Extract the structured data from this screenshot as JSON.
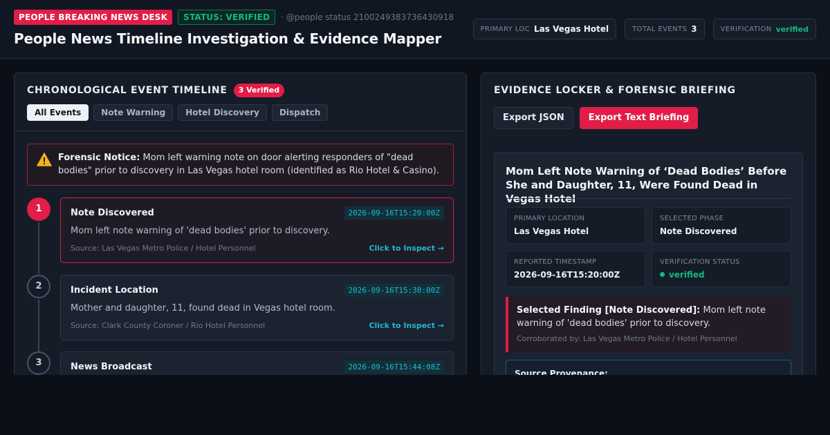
{
  "header": {
    "desk_badge": "PEOPLE BREAKING NEWS DESK",
    "status_badge": "STATUS: VERIFIED",
    "status_id": "· @people status 2100249383736430918",
    "title": "People News Timeline Investigation & Evidence Mapper",
    "stats": [
      {
        "label": "PRIMARY LOC",
        "value": "Las Vegas Hotel"
      },
      {
        "label": "TOTAL EVENTS",
        "value": "3"
      },
      {
        "label": "VERIFICATION",
        "value": "verified"
      }
    ]
  },
  "timeline_panel": {
    "title": "CHRONOLOGICAL EVENT TIMELINE",
    "count_pill": "3 Verified",
    "filters": [
      "All Events",
      "Note Warning",
      "Hotel Discovery",
      "Dispatch"
    ],
    "active_filter": "All Events",
    "notice": {
      "label": "Forensic Notice:",
      "text": "Mom left warning note on door alerting responders of \"dead bodies\" prior to discovery in Las Vegas hotel room (identified as Rio Hotel & Casino).",
      "icon": "warning-icon"
    },
    "events": [
      {
        "number": "1",
        "title": "Note Discovered",
        "timestamp": "2026-09-16T15:20:00Z",
        "description": "Mom left note warning of 'dead bodies' prior to discovery.",
        "source": "Source: Las Vegas Metro Police / Hotel Personnel",
        "inspect": "Click to Inspect →",
        "active": true
      },
      {
        "number": "2",
        "title": "Incident Location",
        "timestamp": "2026-09-16T15:30:00Z",
        "description": "Mother and daughter, 11, found dead in Vegas hotel room.",
        "source": "Source: Clark County Coroner / Rio Hotel Personnel",
        "inspect": "Click to Inspect →",
        "active": false
      },
      {
        "number": "3",
        "title": "News Broadcast",
        "timestamp": "2026-09-16T15:44:08Z",
        "description": "",
        "source": "",
        "inspect": "",
        "active": false
      }
    ]
  },
  "evidence_panel": {
    "title": "EVIDENCE LOCKER & FORENSIC BRIEFING",
    "export_json": "Export JSON",
    "export_text": "Export Text Briefing",
    "headline": "Mom Left Note Warning of ‘Dead Bodies’ Before She and Daughter, 11, Were Found Dead in Vegas Hotel",
    "meta": [
      {
        "label": "PRIMARY LOCATION",
        "value": "Las Vegas Hotel"
      },
      {
        "label": "SELECTED PHASE",
        "value": "Note Discovered"
      },
      {
        "label": "REPORTED TIMESTAMP",
        "value": "2026-09-16T15:20:00Z"
      },
      {
        "label": "VERIFICATION STATUS",
        "value": "verified"
      }
    ],
    "finding": {
      "label": "Selected Finding [Note Discovered]:",
      "text": "Mom left note warning of 'dead bodies' prior to discovery.",
      "source": "Corroborated by: Las Vegas Metro Police / Hotel Personnel"
    },
    "provenance_label": "Source Provenance:"
  },
  "colors": {
    "accent_red": "#e11d48",
    "verified_green": "#10b981",
    "timestamp_cyan": "#22b8cf"
  }
}
